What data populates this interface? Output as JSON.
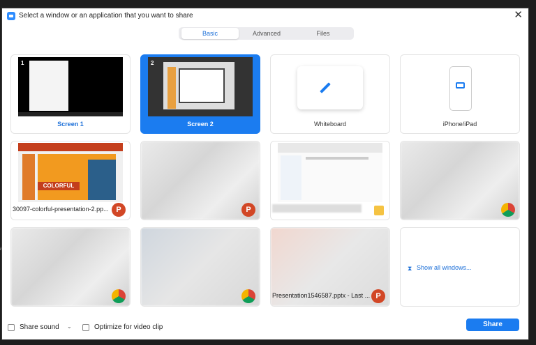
{
  "title": "Select a window or an application that you want to share",
  "tabs": [
    "Basic",
    "Advanced",
    "Files"
  ],
  "tiles": {
    "screen1": "Screen 1",
    "screen2": "Screen 2",
    "whiteboard": "Whiteboard",
    "iphone": "iPhone/iPad",
    "ppt1_name": "30097-colorful-presentation-2.pp...",
    "ppt1_slide_text": "COLORFUL",
    "ppt2_name": "Presentation1546587.pptx - Last ...",
    "show_all": "Show all windows...",
    "screen_numbers": [
      "1",
      "2"
    ],
    "ppt_badge": "P"
  },
  "footer": {
    "share_sound": "Share sound",
    "optimize": "Optimize for video clip",
    "share_button": "Share"
  },
  "side_char": "ar",
  "colors": {
    "accent": "#1b7cf0",
    "powerpoint": "#d24726"
  },
  "icons": [
    "zoom-app-icon",
    "close-icon",
    "pencil-icon",
    "airplay-icon",
    "powerpoint-icon",
    "chrome-icon",
    "folder-icon",
    "windows-icon",
    "chevron-down-icon"
  ]
}
